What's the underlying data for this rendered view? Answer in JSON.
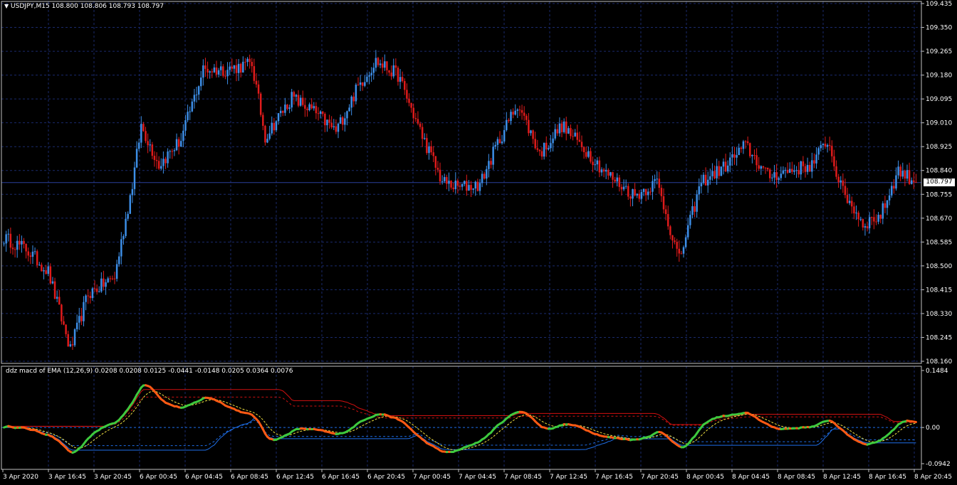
{
  "main_chart": {
    "symbol_caption": "USDJPY,M15",
    "ohlc_caption": "108.800 108.806 108.793 108.797",
    "current_price": "108.797",
    "price_labels": [
      "109.435",
      "109.350",
      "109.265",
      "109.180",
      "109.095",
      "109.010",
      "108.925",
      "108.840",
      "108.755",
      "108.670",
      "108.585",
      "108.500",
      "108.415",
      "108.330",
      "108.245",
      "108.160"
    ],
    "colors": {
      "bull": "#3d8fe8",
      "bear": "#e01b1b",
      "grid": "#1a2a6c",
      "price_line": "#2a3f9a"
    }
  },
  "indicator": {
    "caption": "ddz macd of EMA  (12,26,9) 0.0208 0.0208 0.0125 -0.0441 -0.0148 0.0205 0.0364 0.0076",
    "scale_labels": [
      "0.1484",
      "0.00",
      "-0.0942"
    ],
    "colors": {
      "up": "#3ec93e",
      "down": "#ff5a14",
      "band_upper": "#d01010",
      "band_lower": "#1e6ee8",
      "signal": "#f0e040"
    }
  },
  "time_labels": [
    "3 Apr 2020",
    "3 Apr 16:45",
    "3 Apr 20:45",
    "6 Apr 00:45",
    "6 Apr 04:45",
    "6 Apr 08:45",
    "6 Apr 12:45",
    "6 Apr 16:45",
    "6 Apr 20:45",
    "7 Apr 00:45",
    "7 Apr 04:45",
    "7 Apr 08:45",
    "7 Apr 12:45",
    "7 Apr 16:45",
    "7 Apr 20:45",
    "8 Apr 00:45",
    "8 Apr 04:45",
    "8 Apr 08:45",
    "8 Apr 12:45",
    "8 Apr 16:45",
    "8 Apr 20:45"
  ],
  "chart_data": {
    "type": "candlestick",
    "title": "USDJPY,M15",
    "ylim": [
      108.16,
      109.435
    ],
    "close_path_keypoints": [
      {
        "i": 0,
        "price": 108.6
      },
      {
        "i": 10,
        "price": 108.56
      },
      {
        "i": 20,
        "price": 108.48
      },
      {
        "i": 30,
        "price": 108.2
      },
      {
        "i": 38,
        "price": 108.4
      },
      {
        "i": 50,
        "price": 108.46
      },
      {
        "i": 58,
        "price": 108.79
      },
      {
        "i": 62,
        "price": 109.0
      },
      {
        "i": 70,
        "price": 108.86
      },
      {
        "i": 80,
        "price": 108.95
      },
      {
        "i": 90,
        "price": 109.2
      },
      {
        "i": 100,
        "price": 109.2
      },
      {
        "i": 112,
        "price": 109.22
      },
      {
        "i": 118,
        "price": 108.96
      },
      {
        "i": 130,
        "price": 109.1
      },
      {
        "i": 140,
        "price": 109.05
      },
      {
        "i": 150,
        "price": 108.98
      },
      {
        "i": 160,
        "price": 109.14
      },
      {
        "i": 168,
        "price": 109.23
      },
      {
        "i": 178,
        "price": 109.18
      },
      {
        "i": 188,
        "price": 108.98
      },
      {
        "i": 198,
        "price": 108.8
      },
      {
        "i": 205,
        "price": 108.78
      },
      {
        "i": 215,
        "price": 108.79
      },
      {
        "i": 222,
        "price": 108.92
      },
      {
        "i": 232,
        "price": 109.08
      },
      {
        "i": 242,
        "price": 108.9
      },
      {
        "i": 252,
        "price": 109.0
      },
      {
        "i": 262,
        "price": 108.92
      },
      {
        "i": 272,
        "price": 108.83
      },
      {
        "i": 285,
        "price": 108.75
      },
      {
        "i": 295,
        "price": 108.8
      },
      {
        "i": 305,
        "price": 108.52
      },
      {
        "i": 315,
        "price": 108.8
      },
      {
        "i": 325,
        "price": 108.85
      },
      {
        "i": 335,
        "price": 108.93
      },
      {
        "i": 345,
        "price": 108.82
      },
      {
        "i": 355,
        "price": 108.84
      },
      {
        "i": 365,
        "price": 108.86
      },
      {
        "i": 372,
        "price": 108.95
      },
      {
        "i": 378,
        "price": 108.78
      },
      {
        "i": 388,
        "price": 108.65
      },
      {
        "i": 396,
        "price": 108.68
      },
      {
        "i": 404,
        "price": 108.84
      },
      {
        "i": 412,
        "price": 108.8
      }
    ],
    "current_close": 108.797
  }
}
